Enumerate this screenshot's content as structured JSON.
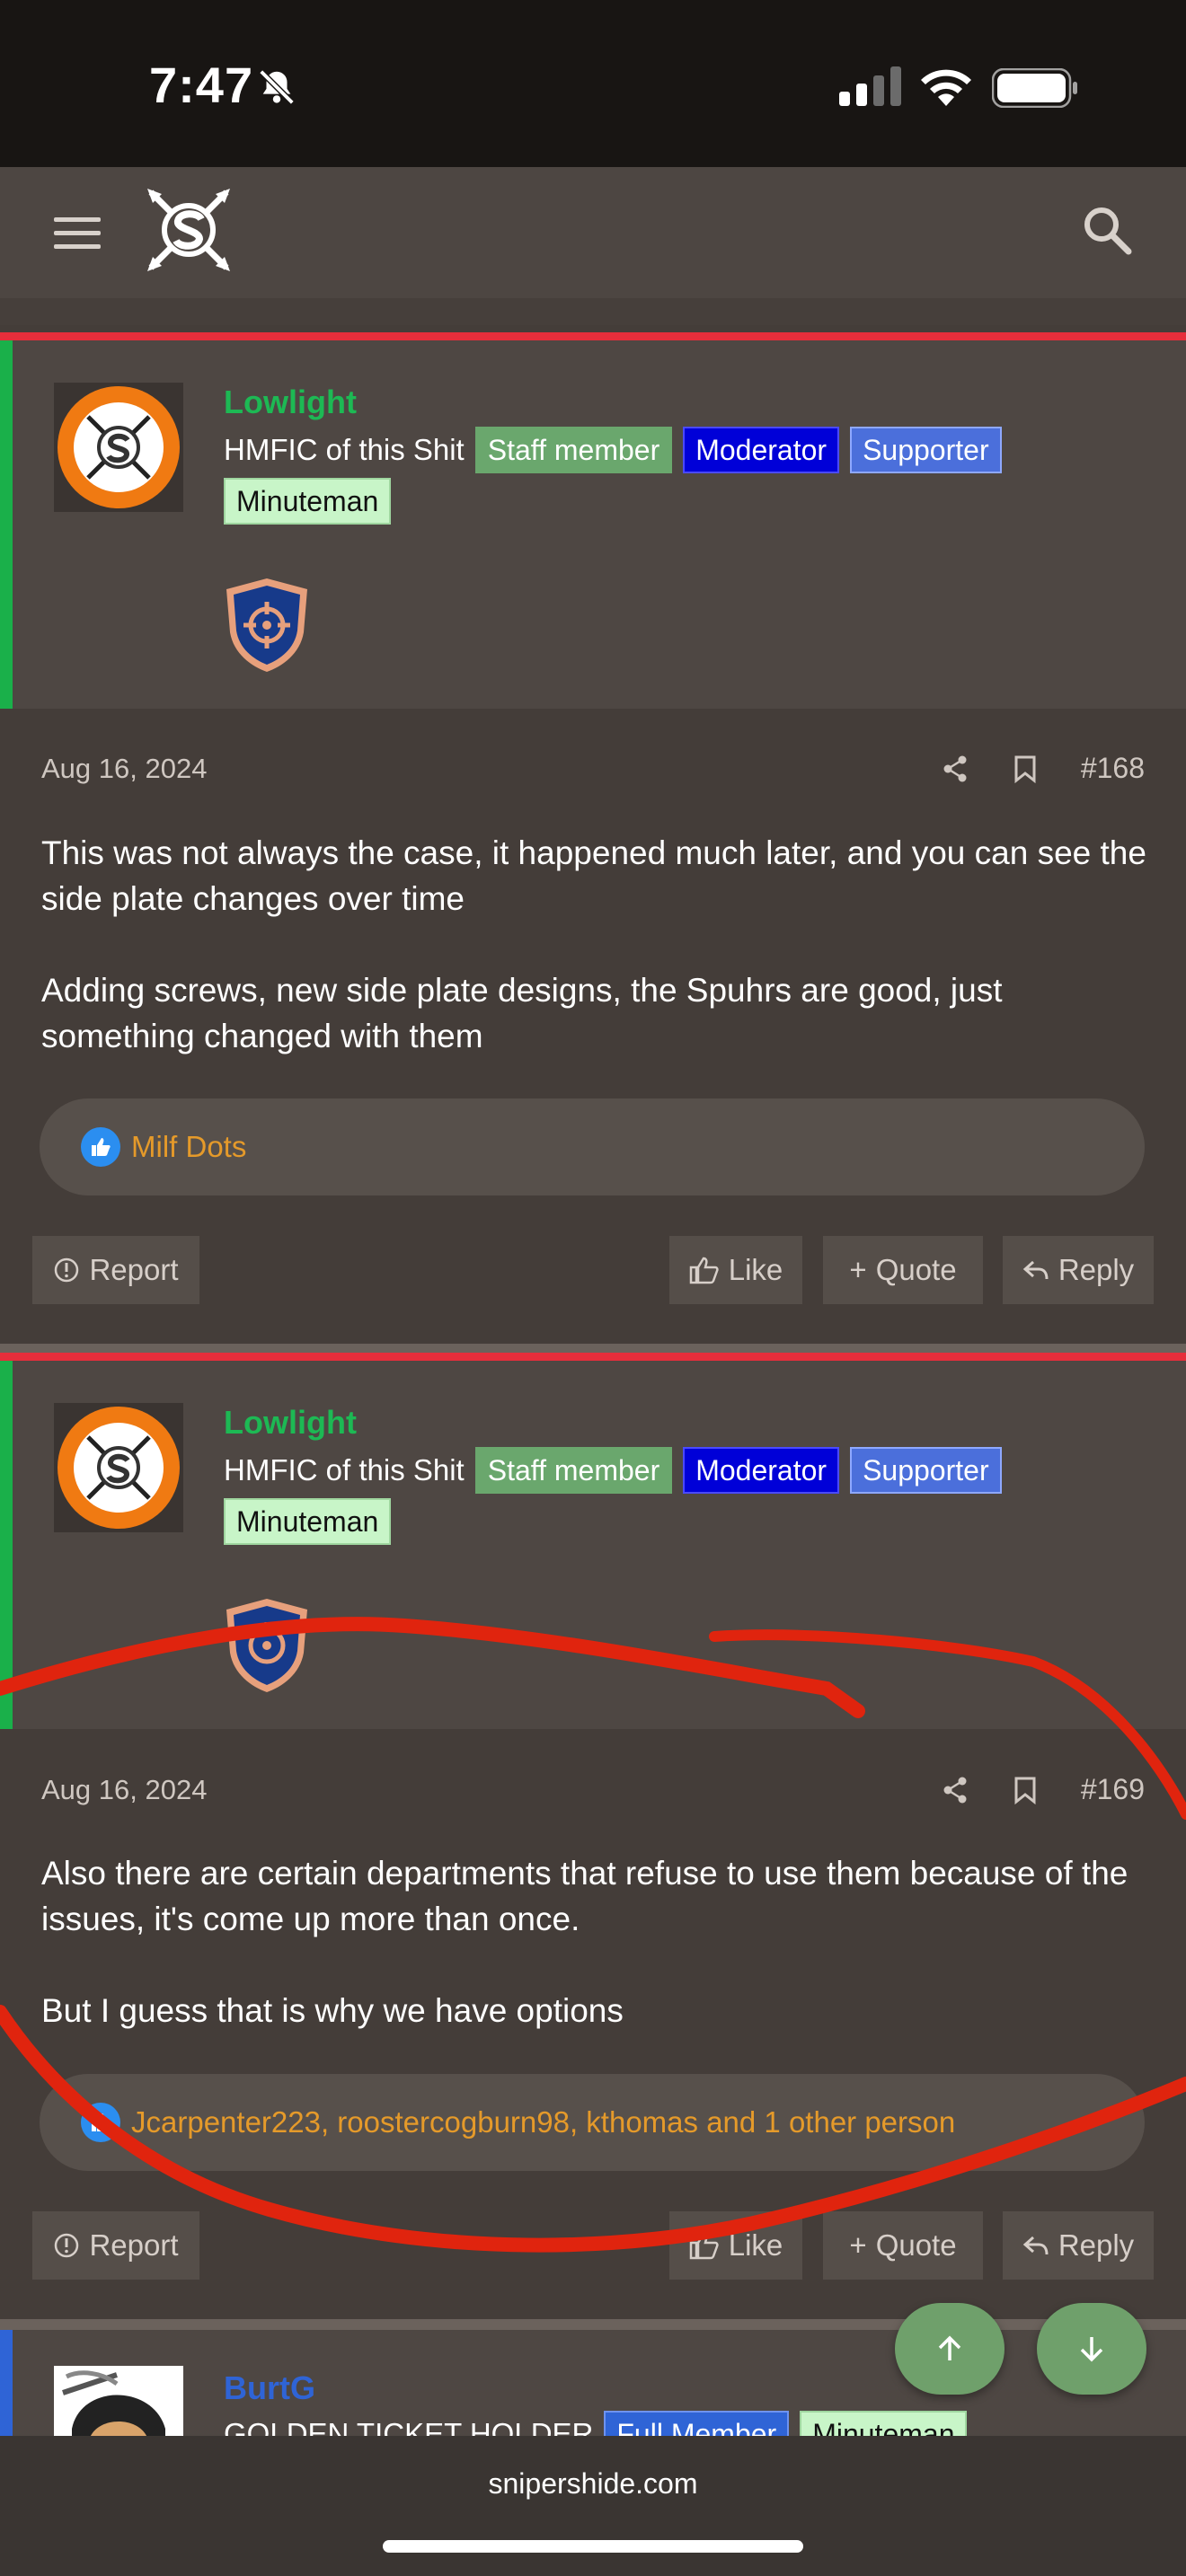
{
  "status": {
    "time": "7:47"
  },
  "site": {
    "domain": "snipershide.com"
  },
  "posts": [
    {
      "username": "Lowlight",
      "user_title": "HMFIC of this Shit",
      "badges": [
        "Staff member",
        "Moderator",
        "Supporter"
      ],
      "badge2": "Minuteman",
      "date": "Aug 16, 2024",
      "number": "#168",
      "paragraphs": [
        "This was not always the case, it happened much later, and you can see the side plate changes over time",
        "Adding screws, new side plate designs, the Spuhrs are good, just something changed with them"
      ],
      "reactions": "Milf Dots",
      "actions": {
        "report": "Report",
        "like": "Like",
        "quote": "Quote",
        "reply": "Reply"
      }
    },
    {
      "username": "Lowlight",
      "user_title": "HMFIC of this Shit",
      "badges": [
        "Staff member",
        "Moderator",
        "Supporter"
      ],
      "badge2": "Minuteman",
      "date": "Aug 16, 2024",
      "number": "#169",
      "paragraphs": [
        "Also there are certain departments that refuse to use them because of the issues, it's come up more than once.",
        "But I guess that is why we have options"
      ],
      "reactions": "Jcarpenter223, roostercogburn98, kthomas and 1 other person",
      "actions": {
        "report": "Report",
        "like": "Like",
        "quote": "Quote",
        "reply": "Reply"
      }
    },
    {
      "username": "BurtG",
      "user_title": "GOLDEN TICKET HOLDER",
      "badges": [
        "Full Member",
        "Minuteman"
      ]
    }
  ],
  "colors": {
    "accent_red": "#e62e3b",
    "username_green": "#1db954",
    "reaction_orange": "#e59a2a",
    "fab_green": "#6fa06b"
  }
}
